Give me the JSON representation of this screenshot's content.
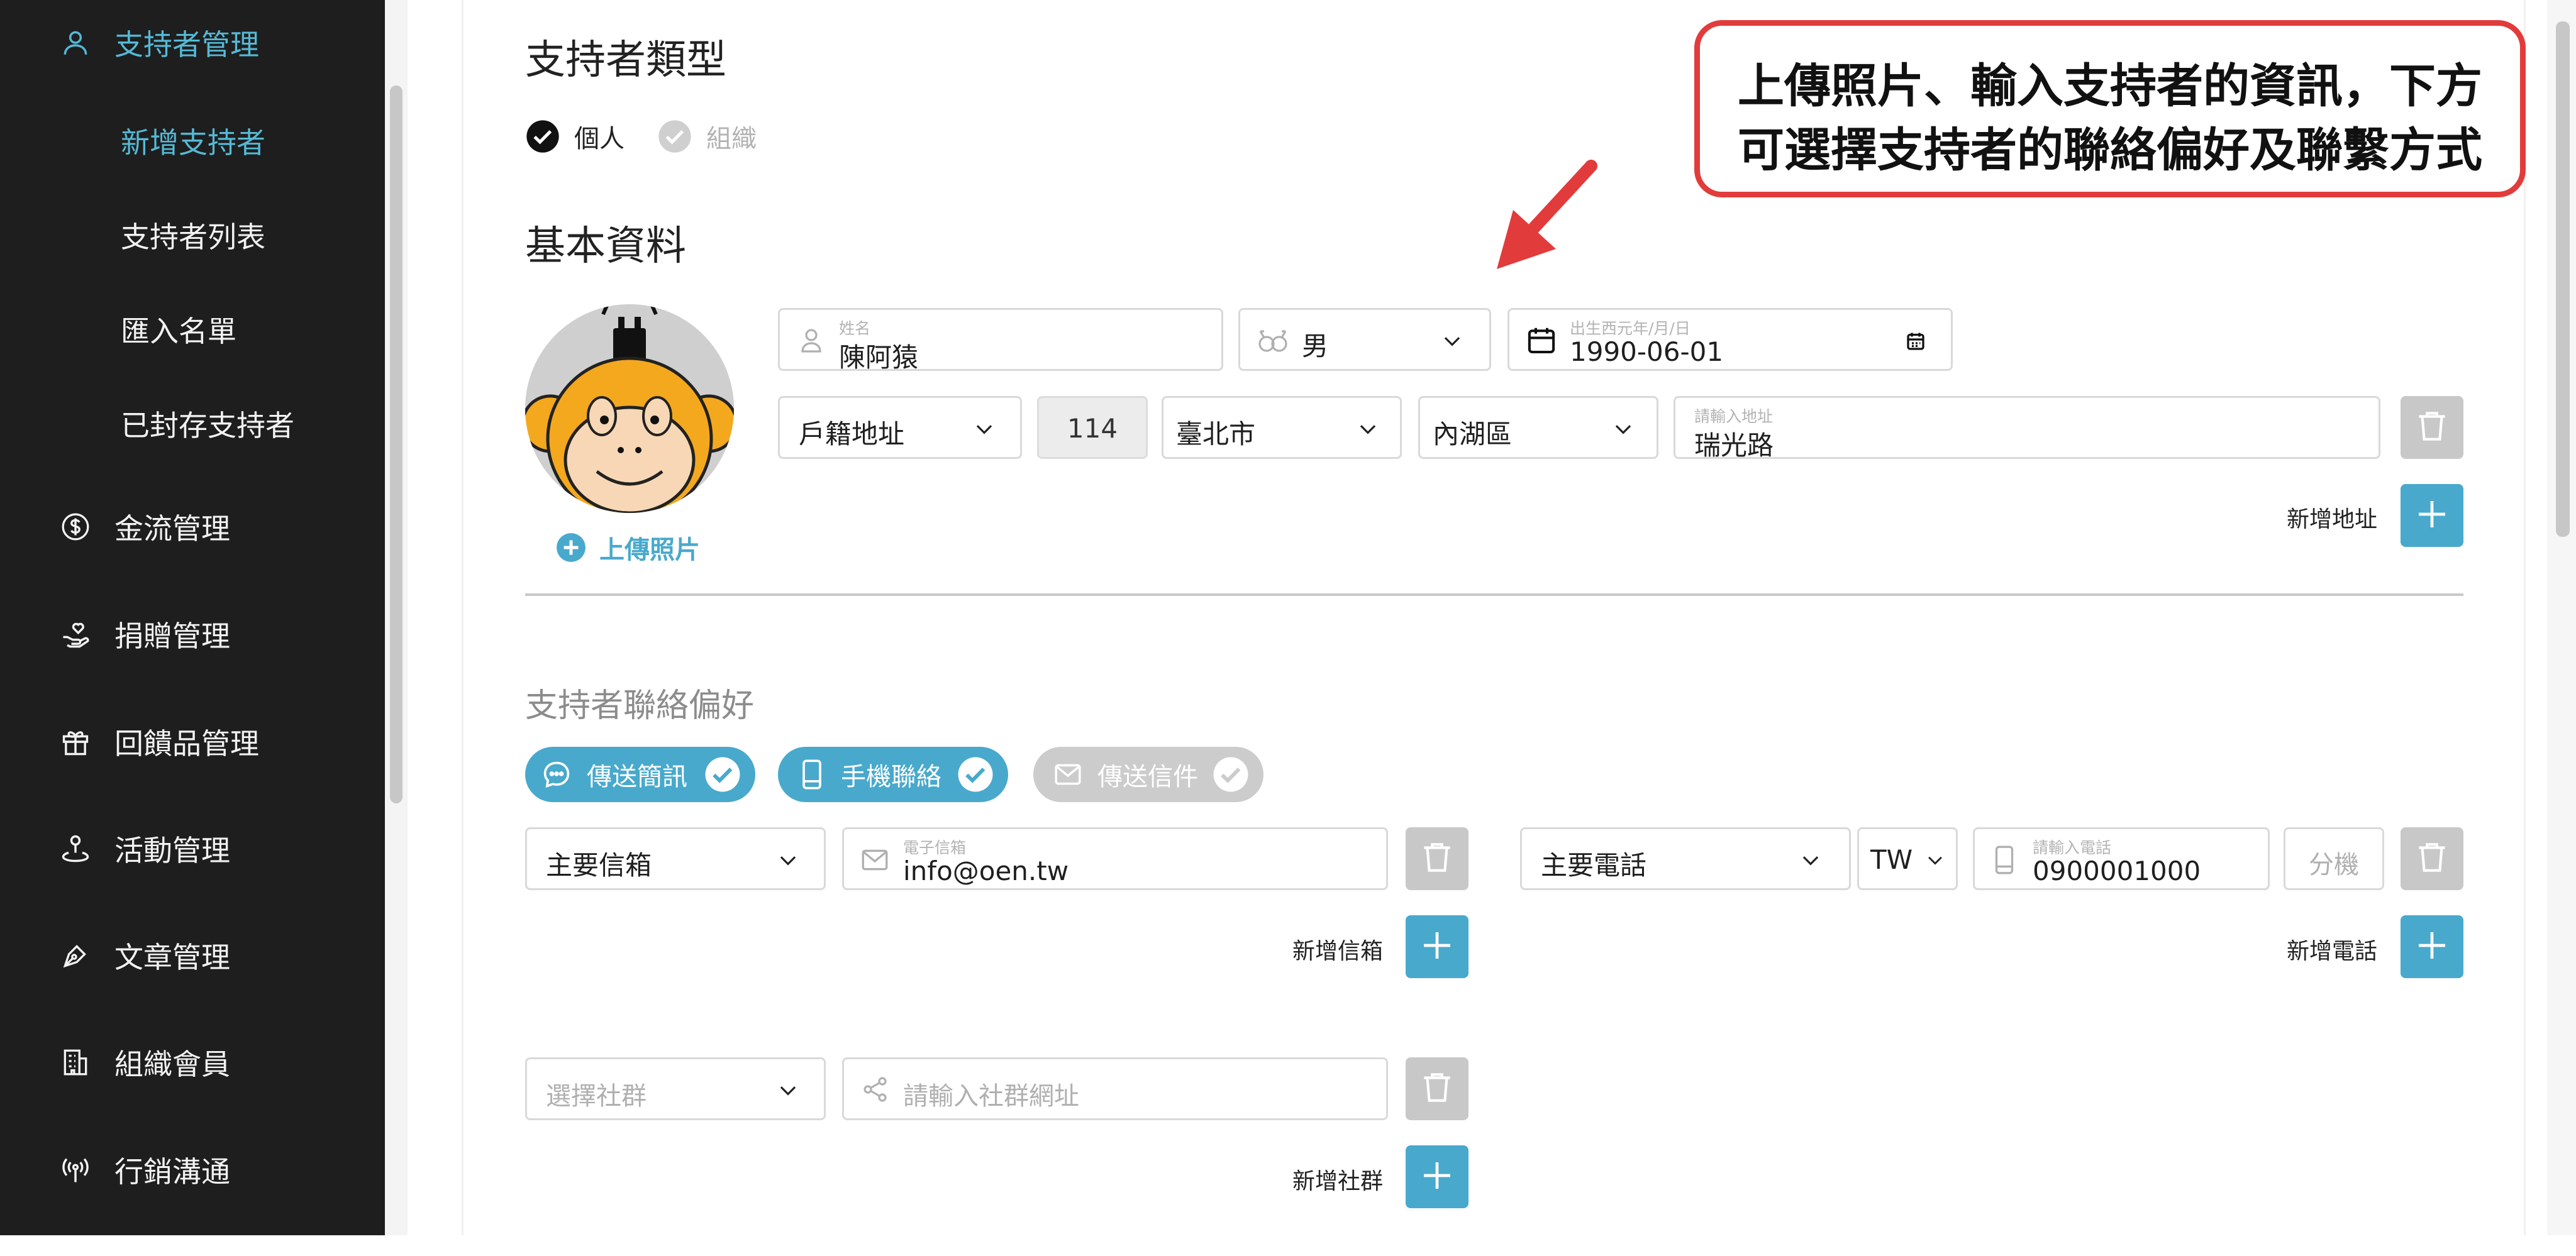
{
  "sidebar": {
    "supporter_mgmt": "支持者管理",
    "sub_items": [
      "新增支持者",
      "支持者列表",
      "匯入名單",
      "已封存支持者"
    ],
    "items": [
      {
        "label": "金流管理",
        "icon": "dollar-circle-icon"
      },
      {
        "label": "捐贈管理",
        "icon": "hand-heart-icon"
      },
      {
        "label": "回饋品管理",
        "icon": "gift-icon"
      },
      {
        "label": "活動管理",
        "icon": "person-marker-icon"
      },
      {
        "label": "文章管理",
        "icon": "pen-nib-icon"
      },
      {
        "label": "組織會員",
        "icon": "building-icon"
      },
      {
        "label": "行銷溝通",
        "icon": "broadcast-icon"
      }
    ]
  },
  "supporter_type": {
    "title": "支持者類型",
    "options": [
      {
        "label": "個人",
        "selected": true
      },
      {
        "label": "組織",
        "selected": false
      }
    ]
  },
  "basic": {
    "title": "基本資料",
    "upload_photo": "上傳照片",
    "name_label": "姓名",
    "name_value": "陳阿猿",
    "gender_value": "男",
    "birth_label": "出生西元年/月/日",
    "birth_value": "1990-06-01",
    "address_type": "戶籍地址",
    "zip": "114",
    "city": "臺北市",
    "district": "內湖區",
    "address_label": "請輸入地址",
    "address_value": "瑞光路",
    "add_address": "新增地址"
  },
  "contact": {
    "title": "支持者聯絡偏好",
    "prefs": [
      {
        "label": "傳送簡訊",
        "on": true
      },
      {
        "label": "手機聯絡",
        "on": true
      },
      {
        "label": "傳送信件",
        "on": false
      }
    ],
    "email_type": "主要信箱",
    "email_label": "電子信箱",
    "email_value": "info@oen.tw",
    "add_email": "新增信箱",
    "phone_type": "主要電話",
    "country": "TW",
    "phone_label": "請輸入電話",
    "phone_value": "0900001000",
    "ext_placeholder": "分機",
    "add_phone": "新增電話",
    "social_placeholder": "選擇社群",
    "social_url_placeholder": "請輸入社群網址",
    "add_social": "新增社群"
  },
  "callout": {
    "line1": "上傳照片、輸入支持者的資訊，下方",
    "line2": "可選擇支持者的聯絡偏好及聯繫方式"
  },
  "colors": {
    "accent": "#48a9cc",
    "sidebar_bg": "#1e1e1e",
    "callout_red": "#e23b3b"
  }
}
